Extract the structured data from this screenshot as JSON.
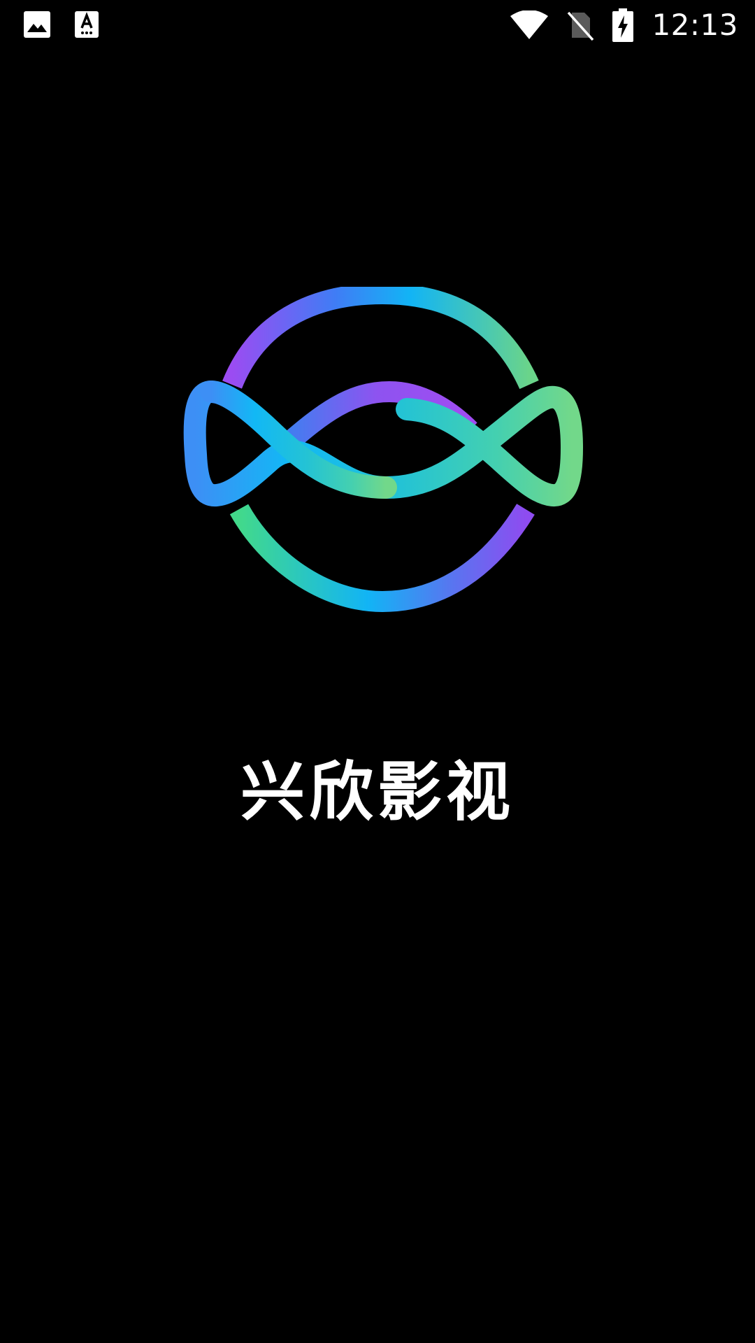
{
  "status_bar": {
    "time": "12:13",
    "left_icons": [
      "image-icon",
      "text-a-icon"
    ],
    "right_icons": [
      "wifi-icon",
      "no-sim-icon",
      "battery-charging-icon"
    ]
  },
  "splash": {
    "title": "兴欣影视",
    "logo": "infinity-orbit-logo"
  },
  "colors": {
    "background": "#000000",
    "text": "#ffffff",
    "logo_blue": "#12b4f5",
    "logo_purple": "#9b4cf2",
    "logo_green": "#5bd98a",
    "logo_cyan": "#1ec7d8"
  }
}
